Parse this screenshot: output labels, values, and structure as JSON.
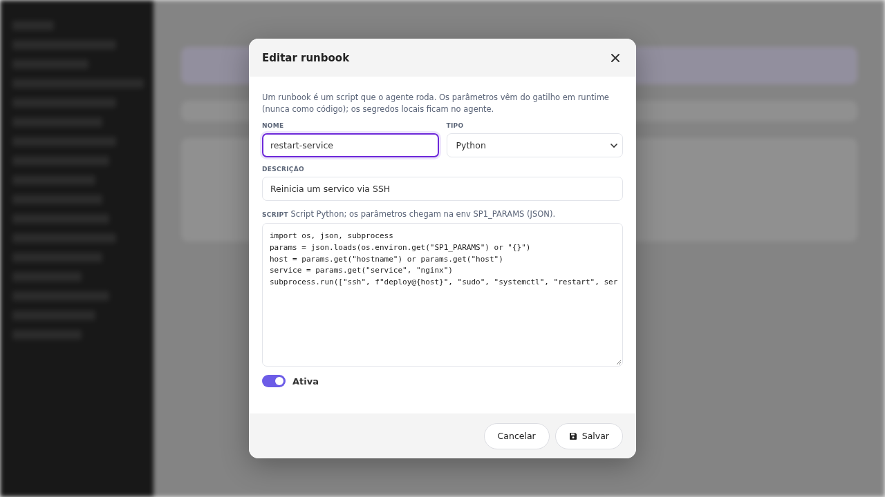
{
  "dialog": {
    "title": "Editar runbook",
    "intro": "Um runbook é um script que o agente roda. Os parâmetros vêm do gatilho em runtime (nunca como código); os segredos locais ficam no agente.",
    "name_field": {
      "label": "NOME",
      "value": "restart-service",
      "focused": true
    },
    "type_field": {
      "label": "TIPO",
      "value": "Python"
    },
    "description_field": {
      "label": "DESCRIÇÃO",
      "value": "Reinicia um servico via SSH"
    },
    "script_field": {
      "label": "SCRIPT",
      "hint": "Script Python; os parâmetros chegam na env SP1_PARAMS (JSON).",
      "lines": [
        "import os, json, subprocess",
        "params = json.loads(os.environ.get(\"SP1_PARAMS\") or \"{}\")",
        "host = params.get(\"hostname\") or params.get(\"host\")",
        "service = params.get(\"service\", \"nginx\")",
        "subprocess.run([\"ssh\", f\"deploy@{host}\", \"sudo\", \"systemctl\", \"restart\", ser"
      ]
    },
    "active_toggle": {
      "label": "Ativa",
      "on": true
    },
    "buttons": [
      {
        "label": "Cancelar",
        "kind": "secondary"
      },
      {
        "label": "Salvar",
        "kind": "save"
      }
    ]
  }
}
